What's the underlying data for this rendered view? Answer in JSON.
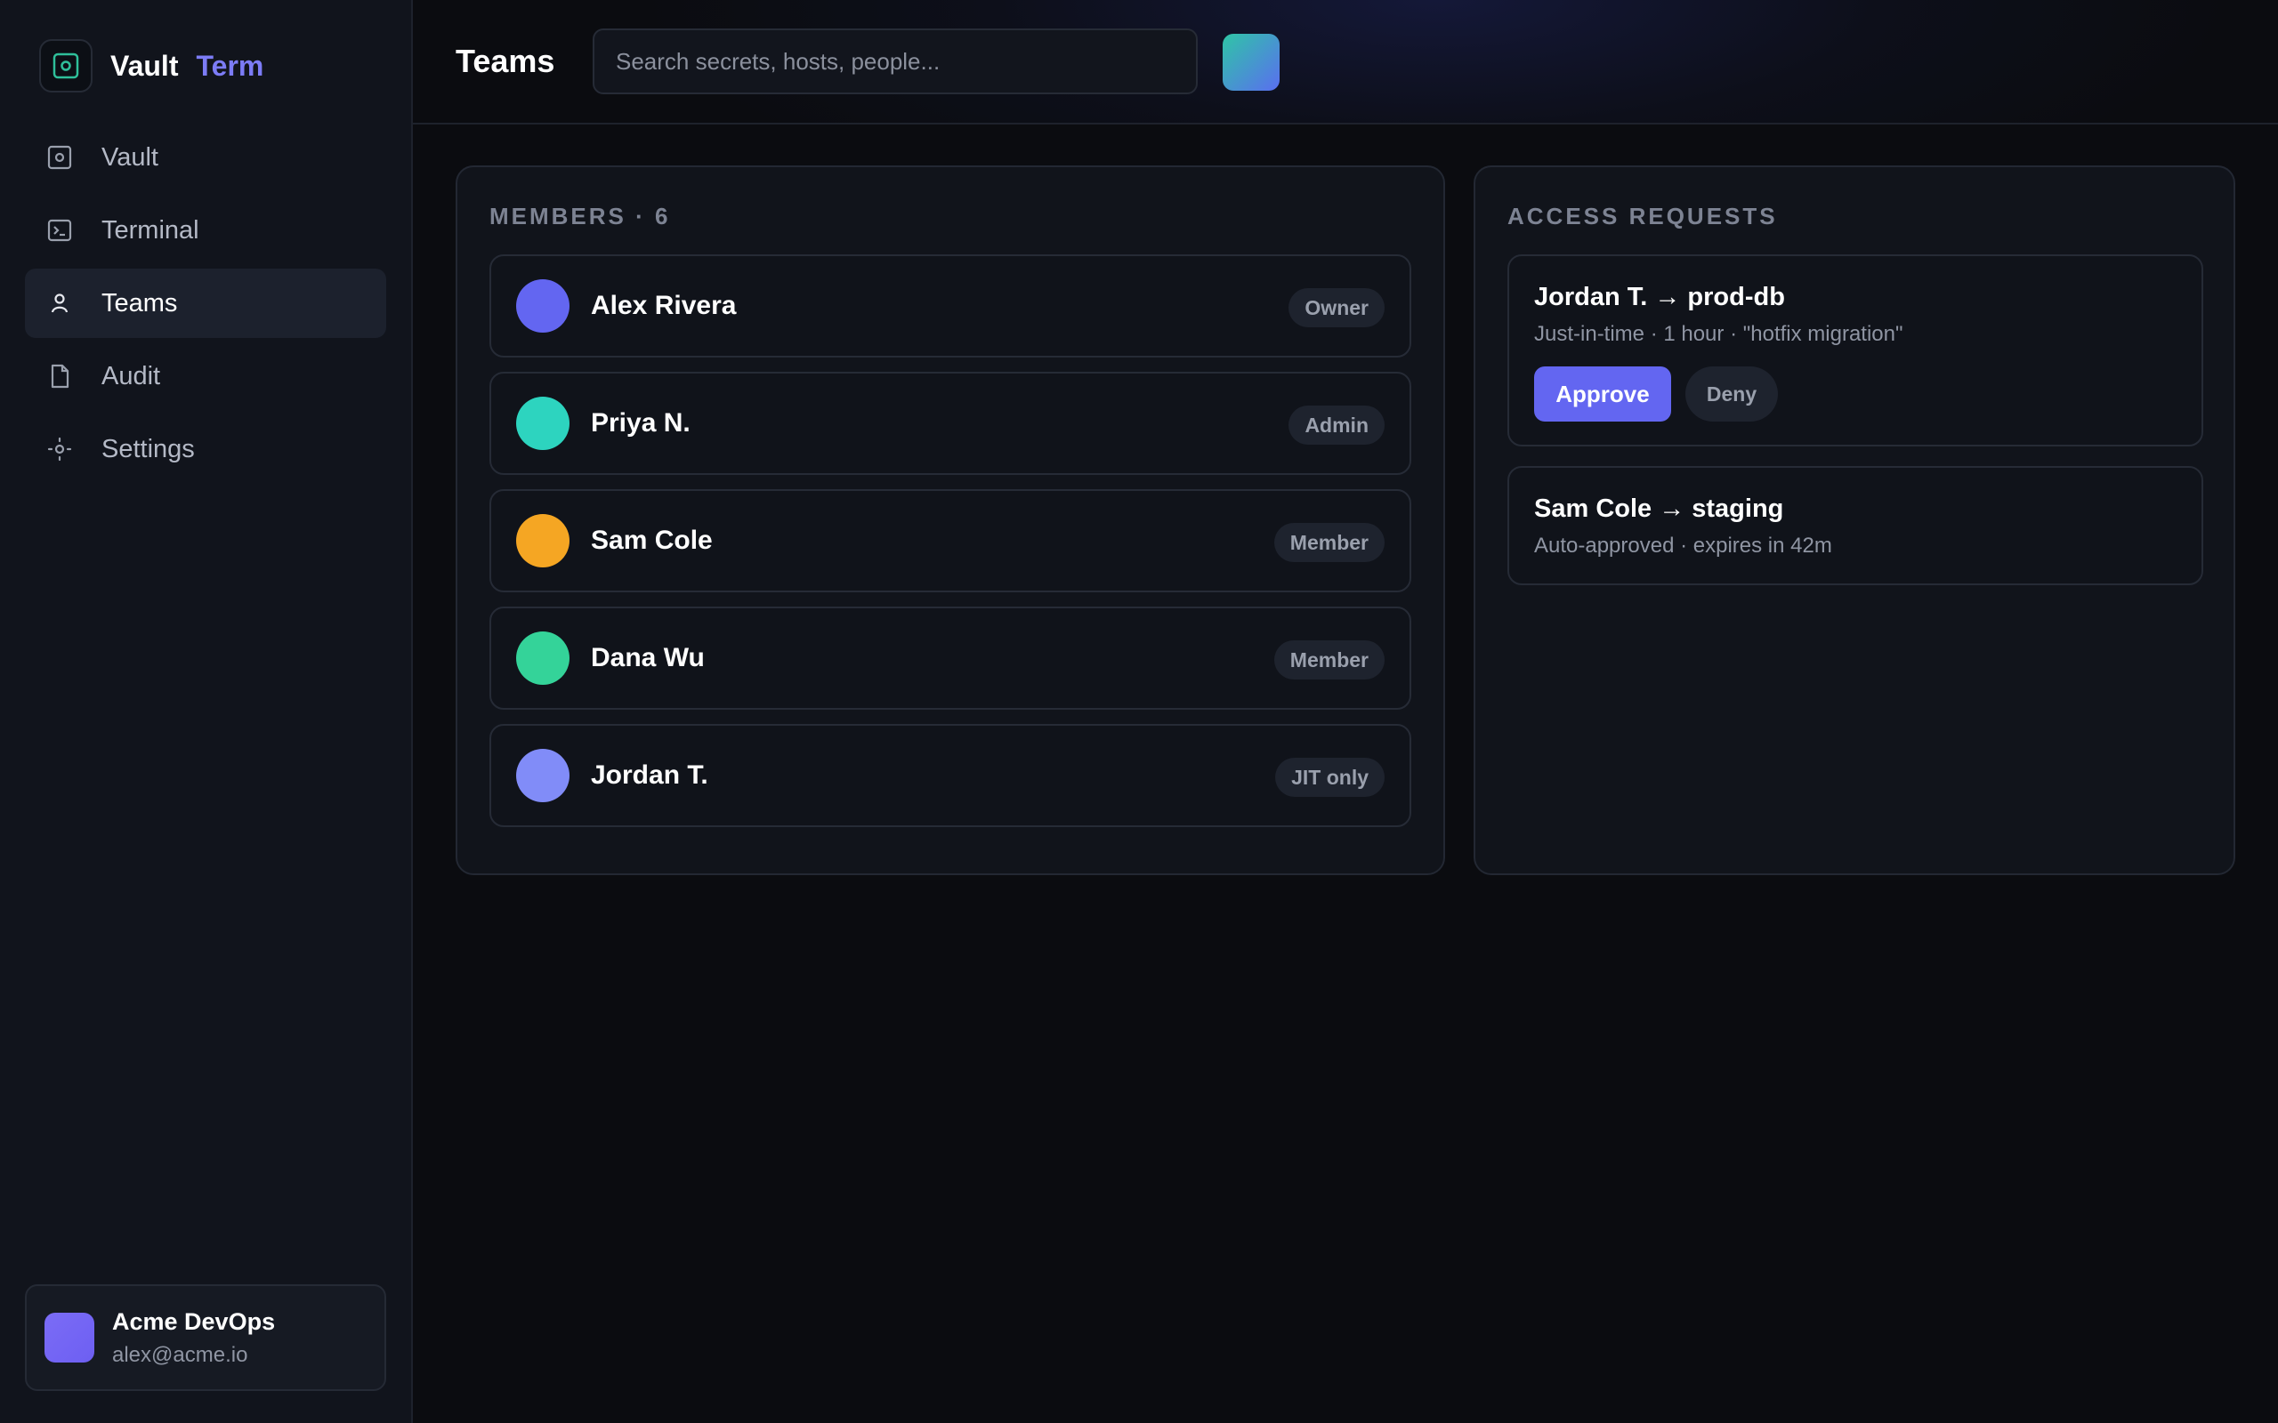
{
  "brand": {
    "name": "Vault",
    "suffix": "Term",
    "icon": "vault-icon",
    "accent": "#7c7cf6"
  },
  "sidebar": {
    "items": [
      {
        "label": "Vault",
        "icon": "vault-icon"
      },
      {
        "label": "Terminal",
        "icon": "terminal-icon"
      },
      {
        "label": "Teams",
        "icon": "user-icon",
        "active": true
      },
      {
        "label": "Audit",
        "icon": "file-icon"
      },
      {
        "label": "Settings",
        "icon": "gear-icon"
      }
    ],
    "account": {
      "name": "Acme DevOps",
      "email": "alex@acme.io"
    }
  },
  "header": {
    "title": "Teams",
    "search_placeholder": "Search secrets, hosts, people..."
  },
  "members": {
    "title": "MEMBERS · 6",
    "list": [
      {
        "name": "Alex Rivera",
        "role": "Owner",
        "color": "#6366f1"
      },
      {
        "name": "Priya N.",
        "role": "Admin",
        "color": "#2dd4bf"
      },
      {
        "name": "Sam Cole",
        "role": "Member",
        "color": "#f5a623"
      },
      {
        "name": "Dana Wu",
        "role": "Member",
        "color": "#34d399"
      },
      {
        "name": "Jordan T.",
        "role": "JIT only",
        "color": "#818cf8"
      }
    ]
  },
  "requests": {
    "title": "ACCESS REQUESTS",
    "items": [
      {
        "title": "Jordan T. → prod-db",
        "detail": "Just-in-time · 1 hour · \"hotfix migration\"",
        "approve_label": "Approve",
        "deny_label": "Deny"
      },
      {
        "title": "Sam Cole → staging",
        "detail": "Auto-approved · expires in 42m"
      }
    ]
  },
  "colors": {
    "primary": "#6366f1",
    "background": "#0b0c10",
    "panel": "#11141b"
  }
}
